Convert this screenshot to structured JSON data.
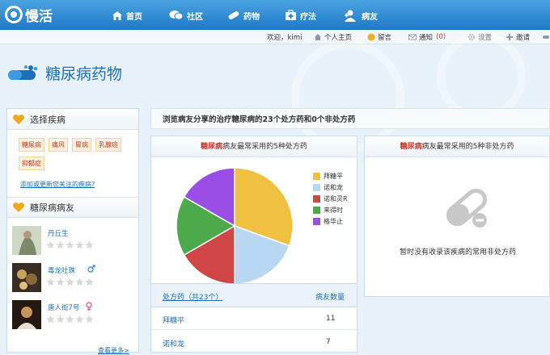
{
  "nav": {
    "logo_text": "慢活",
    "items": [
      {
        "label": "首页",
        "icon": "home-icon"
      },
      {
        "label": "社区",
        "icon": "chat-icon"
      },
      {
        "label": "药物",
        "icon": "pill-icon"
      },
      {
        "label": "疗法",
        "icon": "medkit-icon"
      },
      {
        "label": "病友",
        "icon": "user-plus-icon"
      }
    ]
  },
  "subbar": {
    "welcome": "欢迎，kimi",
    "homepage": "个人主页",
    "message": "留言",
    "notify": "通知",
    "notify_count": "(0)",
    "settings": "设置",
    "invite": "邀请"
  },
  "page_title": "糖尿病药物",
  "left": {
    "disease_title": "选择疾病",
    "diseases": [
      "糖尿病",
      "痛风",
      "胃病",
      "乳腺癌",
      "抑郁症"
    ],
    "add_link": "添加或更新您关注的疾病?",
    "friends_title": "糖尿病病友",
    "friends": [
      {
        "name": "丹丘生",
        "rating": 0
      },
      {
        "name": "毒龙吐珠",
        "rating": 0
      },
      {
        "name": "唐人街7号",
        "rating": 0
      }
    ],
    "more": "查看更多>"
  },
  "banner": "浏览病友分享的治疗糖尿病的23个处方药和0个非处方药",
  "rx_panel": {
    "title_disease": "糖尿病",
    "title_rest": "病友最常采用的5种处方药",
    "col1": "处方药（共23个）",
    "col2": "病友数量",
    "rows": [
      {
        "name": "拜糖平",
        "count": "11"
      },
      {
        "name": "诺和龙",
        "count": "7"
      }
    ]
  },
  "otc_panel": {
    "title_disease": "糖尿病",
    "title_rest": "病友最常采用的5种非处方药",
    "empty_text": "暂时没有收录该疾病的常用非处方药"
  },
  "chart_data": {
    "type": "pie",
    "categories": [
      "拜糖平",
      "诺和龙",
      "诺和灵R",
      "来得时",
      "格华止"
    ],
    "values": [
      11,
      7,
      6,
      6,
      6
    ],
    "colors": [
      "#f0c040",
      "#b7d7f3",
      "#d04545",
      "#4caa4c",
      "#9b4ee6"
    ],
    "legend_position": "right"
  }
}
